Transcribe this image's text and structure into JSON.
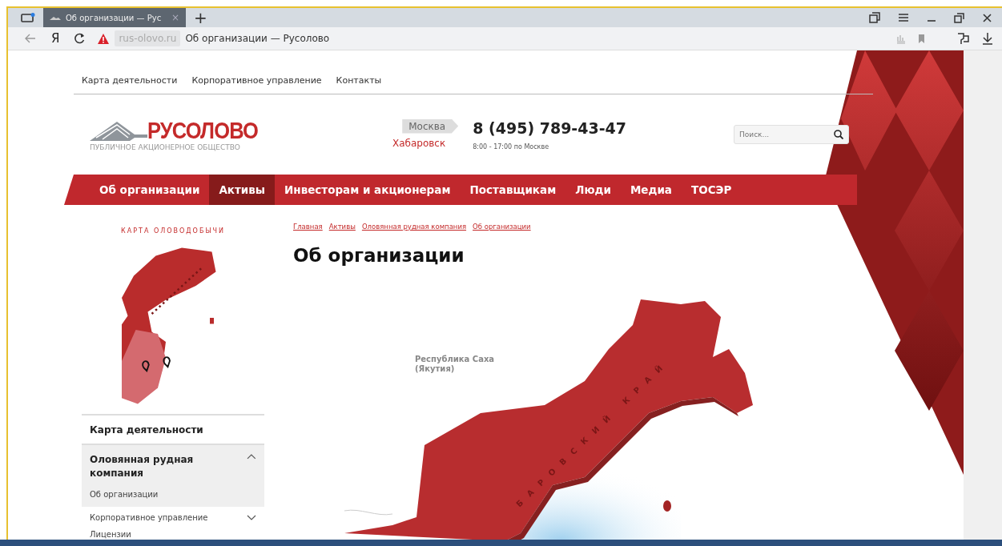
{
  "browser": {
    "tab": {
      "title": "Об организации — Рус",
      "close": "×"
    },
    "new_tab": "+",
    "yandex": "Я",
    "address": {
      "domain": "rus-olovo.ru",
      "title": "Об организации — Русолово"
    }
  },
  "top_links": [
    "Карта деятельности",
    "Корпоративное управление",
    "Контакты"
  ],
  "logo": {
    "name": "РУСОЛОВО",
    "subtitle": "ПУБЛИЧНОЕ АКЦИОНЕРНОЕ ОБЩЕСТВО"
  },
  "cities": [
    {
      "name": "Москва",
      "selected": true
    },
    {
      "name": "Хабаровск",
      "selected": false
    }
  ],
  "phone": "8 (495) 789-43-47",
  "hours": "8:00 - 17:00 по Москве",
  "search": {
    "placeholder": "Поиск..."
  },
  "nav": [
    {
      "label": "Об организации",
      "selected": false
    },
    {
      "label": "Активы",
      "selected": true
    },
    {
      "label": "Инвесторам и акционерам",
      "selected": false
    },
    {
      "label": "Поставщикам",
      "selected": false
    },
    {
      "label": "Люди",
      "selected": false
    },
    {
      "label": "Медиа",
      "selected": false
    },
    {
      "label": "ТОСЭР",
      "selected": false
    }
  ],
  "sidebar": {
    "map_title": "КАРТА ОЛОВОДОБЫЧИ",
    "menu": [
      {
        "kind": "heading",
        "label": "Карта деятельности"
      },
      {
        "kind": "group",
        "label": "Оловянная рудная компания",
        "expanded": true,
        "children": [
          {
            "label": "Об организации"
          }
        ]
      },
      {
        "kind": "item",
        "label": "Корпоративное управление",
        "expanded": false
      },
      {
        "kind": "item",
        "label": "Лицензии"
      }
    ]
  },
  "breadcrumbs": [
    "Главная",
    "Активы",
    "Оловянная рудная компания",
    "Об организации"
  ],
  "title": "Об организации",
  "map": {
    "region_label": "Республика Саха (Якутия)",
    "territory_label": "БАРОВСКИЙ КРАЙ"
  }
}
